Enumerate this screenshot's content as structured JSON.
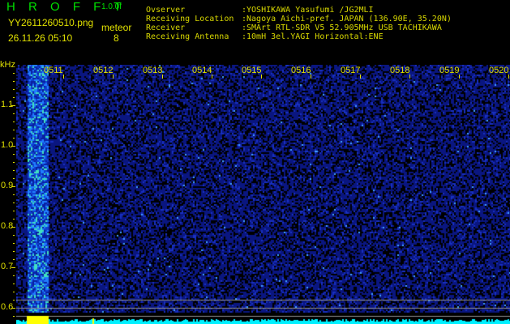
{
  "header": {
    "app_name": "H R O F F T",
    "version": "1.0.0f",
    "filename": "YY2611260510.png",
    "datetime": "26.11.26 05:10",
    "mode_label": "meteor",
    "count": "8",
    "info": [
      {
        "label": "Ovserver",
        "value": ":YOSHIKAWA Yasufumi /JG2MLI"
      },
      {
        "label": "Receiving Location",
        "value": ":Nagoya Aichi-pref. JAPAN (136.90E, 35.20N)"
      },
      {
        "label": "Receiver",
        "value": ":SMArt RTL-SDR V5 52.905MHz USB TACHIKAWA"
      },
      {
        "label": "Receiving Antenna",
        "value": ":10mH 3el.YAGI Horizontal:ENE"
      }
    ]
  },
  "axis": {
    "y_unit": "kHz",
    "y_ticks": [
      "1.1",
      "1.0",
      "0.9",
      "0.8",
      "0.7",
      "0.6"
    ],
    "x_ticks": [
      "0511",
      "0512",
      "0513",
      "0514",
      "0515",
      "0516",
      "0517",
      "0518",
      "0519",
      "0520"
    ]
  },
  "colors": {
    "title": "#00e000",
    "text": "#e0e000",
    "noise": "#0a1a9a",
    "signal": "#00e0ff"
  }
}
